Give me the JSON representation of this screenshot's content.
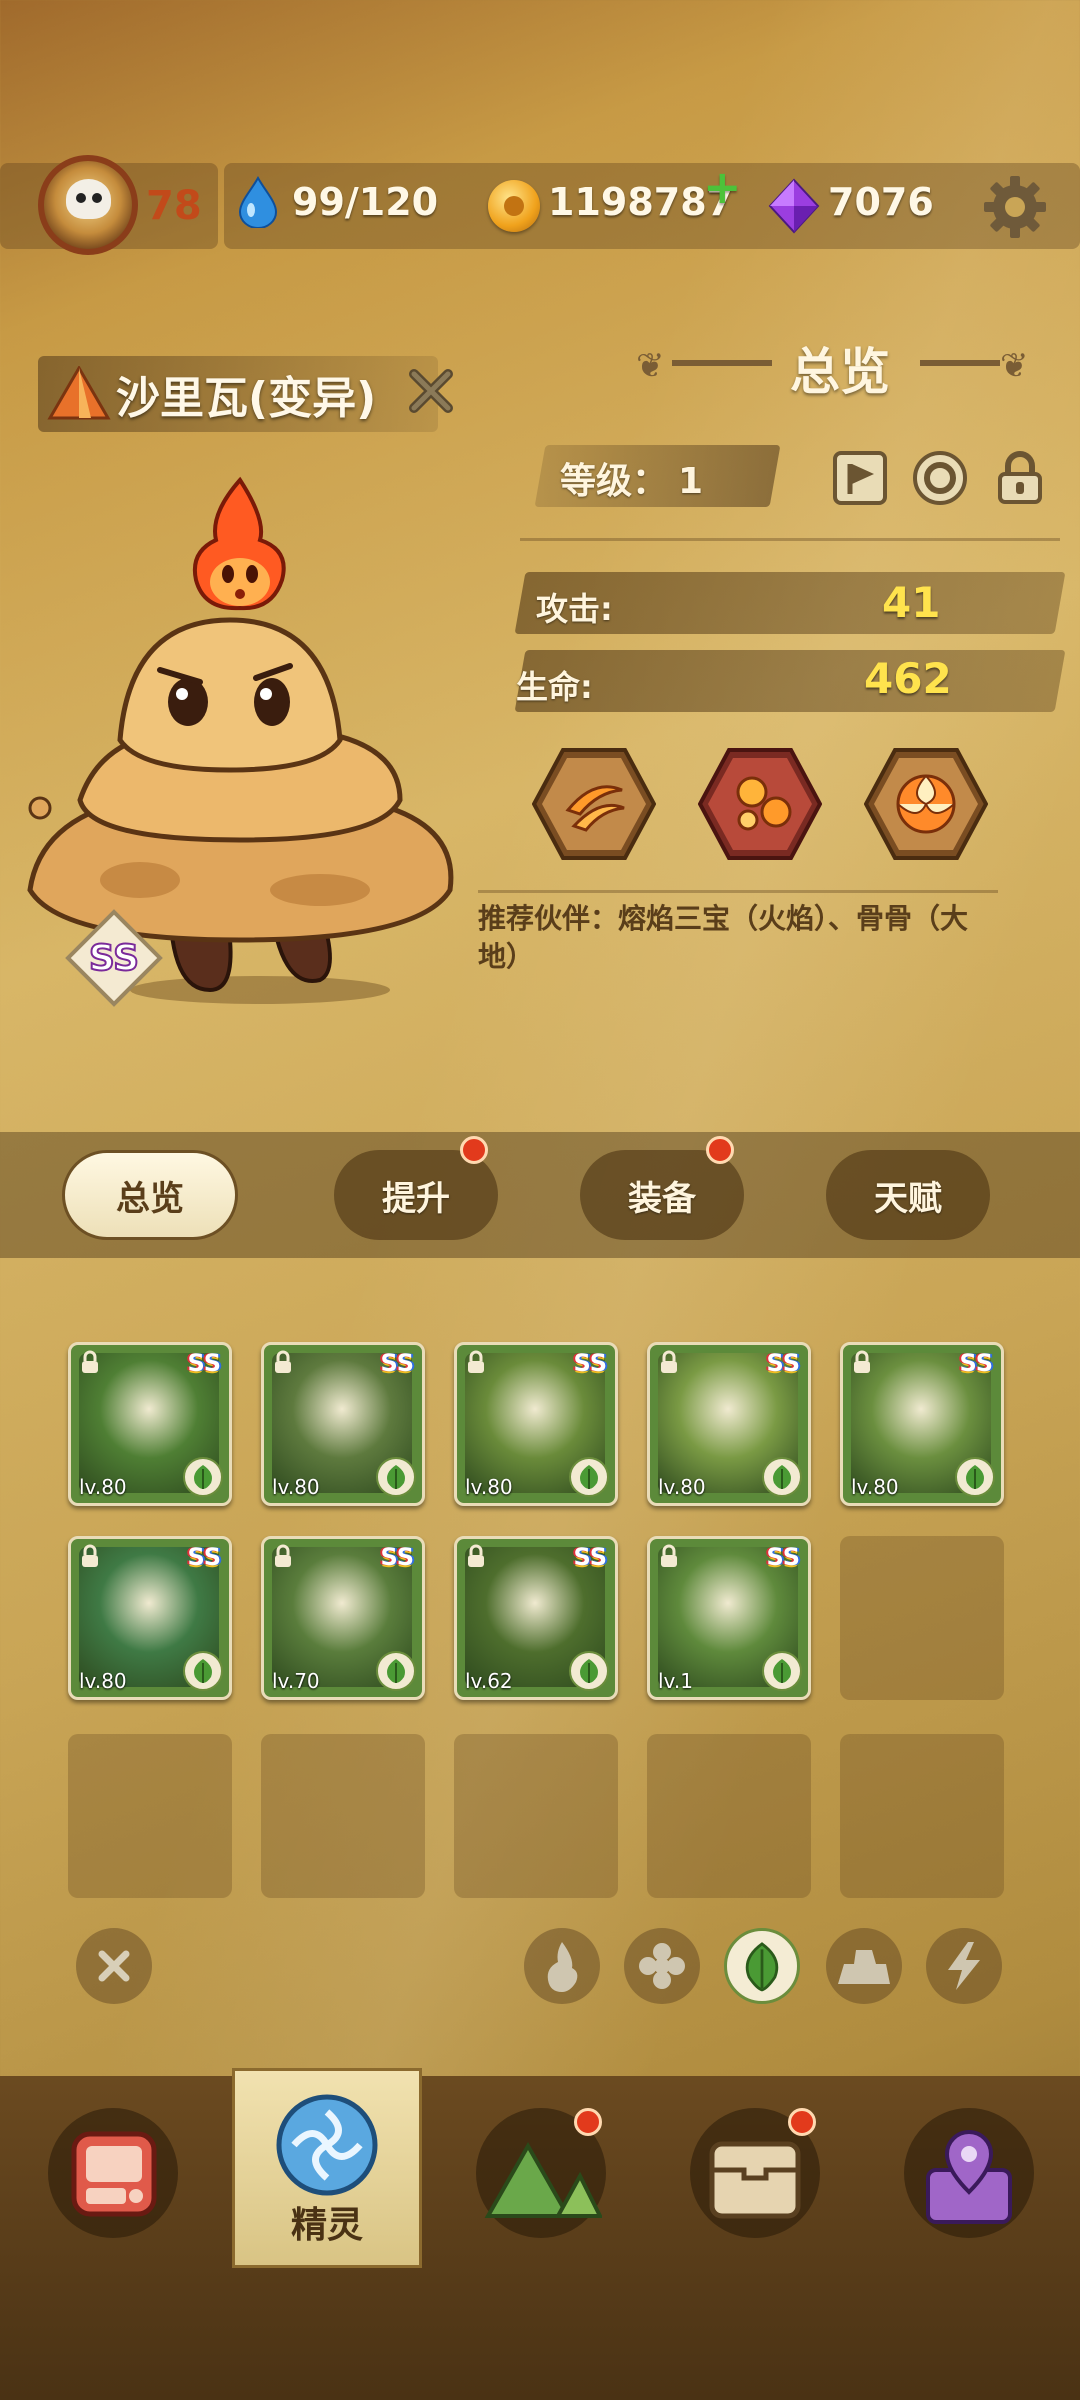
{
  "topbar": {
    "player_level": "78",
    "stamina": "99/120",
    "coins": "1198787",
    "coins_add": "+",
    "gems": "7076"
  },
  "spirit": {
    "name": "沙里瓦(变异)",
    "panel_title": "总览",
    "level_label": "等级：",
    "level_value": "1",
    "attack_label": "攻击:",
    "attack_value": "41",
    "hp_label": "生命:",
    "hp_value": "462",
    "rank": "SS",
    "recommend": "推荐伙伴：熔焰三宝（火焰）、骨骨（大地）"
  },
  "tabs": [
    {
      "label": "总览",
      "active": true,
      "badge": false
    },
    {
      "label": "提升",
      "active": false,
      "badge": true
    },
    {
      "label": "装备",
      "active": false,
      "badge": true
    },
    {
      "label": "天赋",
      "active": false,
      "badge": false
    }
  ],
  "roster": [
    {
      "name": "hooded-spirit",
      "rank": "SS",
      "level": "lv.80",
      "color": "#4f7f34"
    },
    {
      "name": "panda-spirit",
      "rank": "SS",
      "level": "lv.80",
      "color": "#5e7a3e"
    },
    {
      "name": "cactus-spirit",
      "rank": "SS",
      "level": "lv.80",
      "color": "#6a8b3a"
    },
    {
      "name": "leaf-fox-spirit",
      "rank": "SS",
      "level": "lv.80",
      "color": "#7a9a44"
    },
    {
      "name": "monkey-spirit",
      "rank": "SS",
      "level": "lv.80",
      "color": "#6b8f3f"
    },
    {
      "name": "serpent-spirit",
      "rank": "SS",
      "level": "lv.80",
      "color": "#3f7a45"
    },
    {
      "name": "wolf-spirit",
      "rank": "SS",
      "level": "lv.70",
      "color": "#5a7d3c"
    },
    {
      "name": "treant-spirit",
      "rank": "SS",
      "level": "lv.62",
      "color": "#4e6e2d"
    },
    {
      "name": "parrot-spirit",
      "rank": "SS",
      "level": "lv.1",
      "color": "#5f8a3c"
    }
  ],
  "filters": [
    "close-icon",
    "fire-icon",
    "snowflake-icon",
    "leaf-icon",
    "earth-icon",
    "lightning-icon"
  ],
  "bottom_nav": [
    {
      "icon": "shop-icon",
      "badge": false
    },
    {
      "icon": "spirit-icon",
      "label": "精灵",
      "active": true,
      "badge": false
    },
    {
      "icon": "mountain-icon",
      "badge": true
    },
    {
      "icon": "chest-icon",
      "badge": true
    },
    {
      "icon": "map-pin-icon",
      "badge": false
    }
  ],
  "colors": {
    "accent_gold": "#ffe34d",
    "badge_red": "#e23a1c",
    "leaf_green": "#6b8d3c"
  }
}
